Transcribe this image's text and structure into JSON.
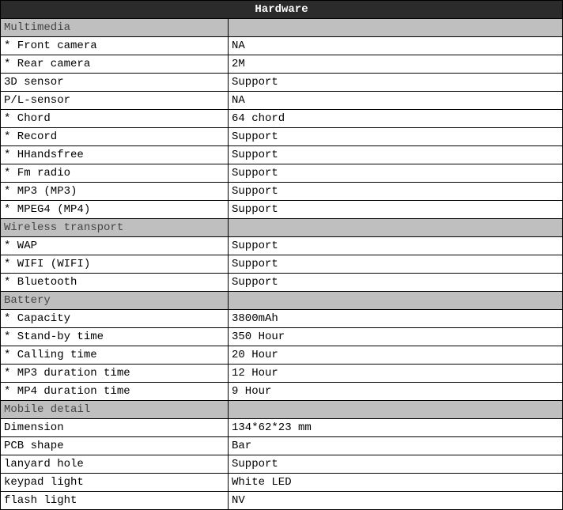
{
  "header": "Hardware",
  "sections": [
    {
      "title": "Multimedia",
      "rows": [
        {
          "label": "* Front camera",
          "value": "NA"
        },
        {
          "label": "* Rear camera",
          "value": "2M"
        },
        {
          "label": "3D sensor",
          "value": "Support"
        },
        {
          "label": "P/L-sensor",
          "value": "NA"
        },
        {
          "label": "* Chord",
          "value": "64 chord"
        },
        {
          "label": "* Record",
          "value": "Support"
        },
        {
          "label": "* HHandsfree",
          "value": "Support"
        },
        {
          "label": "* Fm radio",
          "value": "Support"
        },
        {
          "label": "* MP3 (MP3)",
          "value": "Support"
        },
        {
          "label": "* MPEG4 (MP4)",
          "value": "Support"
        }
      ]
    },
    {
      "title": "Wireless transport",
      "rows": [
        {
          "label": "* WAP",
          "value": "Support"
        },
        {
          "label": "* WIFI (WIFI)",
          "value": "Support"
        },
        {
          "label": "* Bluetooth",
          "value": "Support"
        }
      ]
    },
    {
      "title": "Battery",
      "rows": [
        {
          "label": "* Capacity",
          "value": "3800mAh"
        },
        {
          "label": "* Stand-by time",
          "value": "350 Hour"
        },
        {
          "label": "* Calling time",
          "value": "20 Hour"
        },
        {
          "label": "* MP3 duration time",
          "value": "12 Hour"
        },
        {
          "label": "* MP4 duration time",
          "value": "9 Hour"
        }
      ]
    },
    {
      "title": "Mobile detail",
      "rows": [
        {
          "label": "Dimension",
          "value": "134*62*23 mm"
        },
        {
          "label": "PCB shape",
          "value": "Bar"
        },
        {
          "label": "lanyard hole",
          "value": "Support"
        },
        {
          "label": "keypad light",
          "value": "White LED"
        },
        {
          "label": "flash light",
          "value": "NV"
        }
      ]
    }
  ]
}
